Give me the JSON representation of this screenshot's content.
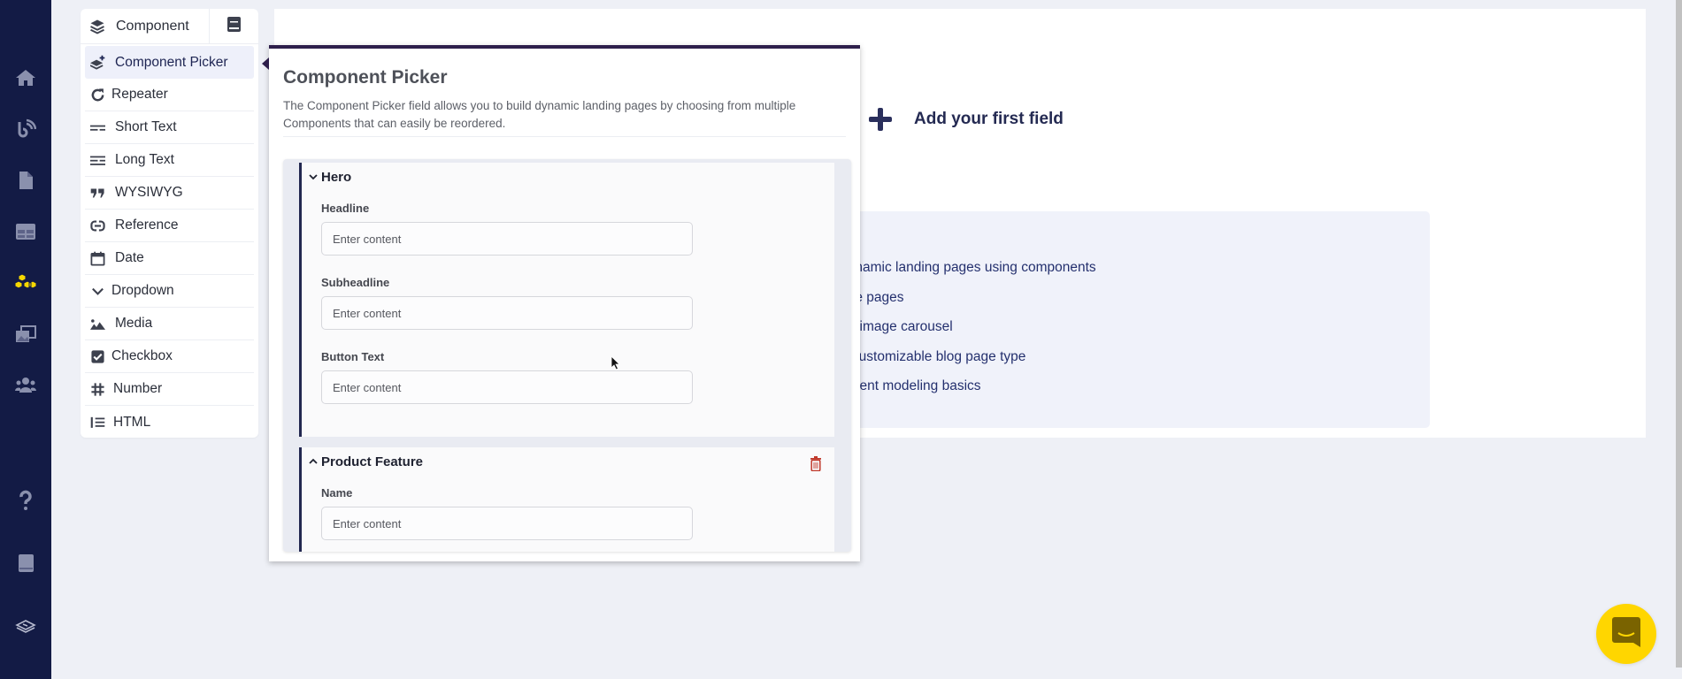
{
  "sidebar": {
    "nav": [
      {
        "name": "home",
        "icon": "home-icon"
      },
      {
        "name": "blog",
        "icon": "blog-feed-icon"
      },
      {
        "name": "pages",
        "icon": "document-icon"
      },
      {
        "name": "tables",
        "icon": "table-icon"
      },
      {
        "name": "components",
        "icon": "components-cubes-icon",
        "active": true,
        "active_color": "#f7d800"
      },
      {
        "name": "media",
        "icon": "media-gallery-icon"
      },
      {
        "name": "users",
        "icon": "users-icon"
      }
    ],
    "bottom": [
      {
        "name": "help",
        "icon": "question-icon"
      },
      {
        "name": "docs",
        "icon": "book-icon"
      },
      {
        "name": "workspace",
        "icon": "layers-logo-icon"
      }
    ]
  },
  "field_menu": {
    "header": {
      "label": "Component",
      "icon": "layers-icon",
      "docs_icon": "book-icon"
    },
    "items": [
      {
        "label": "Component Picker",
        "icon": "layers-plus-icon",
        "active": true
      },
      {
        "label": "Repeater",
        "icon": "repeat-icon"
      },
      {
        "label": "Short Text",
        "icon": "short-text-icon"
      },
      {
        "label": "Long Text",
        "icon": "long-text-icon"
      },
      {
        "label": "WYSIWYG",
        "icon": "quote-icon"
      },
      {
        "label": "Reference",
        "icon": "link-icon"
      },
      {
        "label": "Date",
        "icon": "calendar-icon"
      },
      {
        "label": "Dropdown",
        "icon": "chevron-down-icon"
      },
      {
        "label": "Media",
        "icon": "image-icon"
      },
      {
        "label": "Checkbox",
        "icon": "checkbox-icon"
      },
      {
        "label": "Number",
        "icon": "hash-icon"
      },
      {
        "label": "HTML",
        "icon": "list-icon"
      }
    ]
  },
  "popover": {
    "title": "Component Picker",
    "description": "The Component Picker field allows you to build dynamic landing pages by choosing from multiple Components that can easily be reordered.",
    "blocks": [
      {
        "title": "Hero",
        "expanded": true,
        "fields": [
          {
            "label": "Headline",
            "placeholder": "Enter content"
          },
          {
            "label": "Subheadline",
            "placeholder": "Enter content"
          },
          {
            "label": "Button Text",
            "placeholder": "Enter content"
          }
        ]
      },
      {
        "title": "Product Feature",
        "expanded": false,
        "fields": [
          {
            "label": "Name",
            "placeholder": "Enter content"
          }
        ]
      }
    ]
  },
  "main": {
    "add_field_label": "Add your first field",
    "links": [
      "dynamic landing pages using components",
      "rize pages",
      "an image carousel",
      "a customizable blog page type",
      "ontent modeling basics"
    ]
  },
  "colors": {
    "sidebar_bg": "#131b45",
    "accent": "#f7d800",
    "popover_border": "#2e1f4b",
    "link": "#24306e",
    "danger": "#c0392b"
  }
}
